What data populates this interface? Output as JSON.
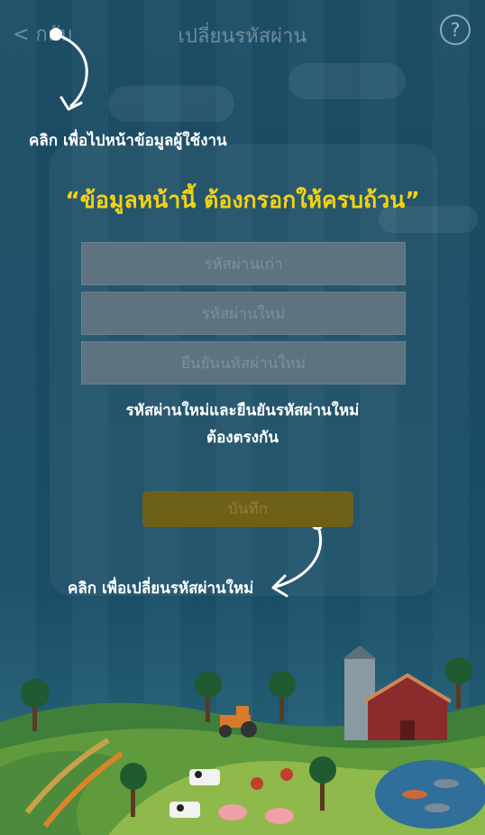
{
  "header": {
    "back_label": "< กลับ",
    "title": "เปลี่ยนรหัสผ่าน",
    "help_label": "?"
  },
  "hints": {
    "back_hint": "คลิก  เพื่อไปหน้าข้อมูลผู้ใช้งาน",
    "save_hint": "คลิก  เพื่อเปลี่ยนรหัสผ่านใหม่"
  },
  "form": {
    "warning": "“ข้อมูลหน้านี้  ต้องกรอกให้ครบถ้วน”",
    "old_password_placeholder": "รหัสผ่านเก่า",
    "new_password_placeholder": "รหัสผ่านใหม่",
    "confirm_password_placeholder": "ยืนยันนหัสผ่านใหม่",
    "match_note_line1": "รหัสผ่านใหม่และยืนยันรหัสผ่านใหม่",
    "match_note_line2": "ต้องตรงกัน",
    "save_label": "บันทึก"
  },
  "colors": {
    "accent_yellow": "#f5d311",
    "save_button": "#6f6018",
    "background": "#1d4f66"
  }
}
